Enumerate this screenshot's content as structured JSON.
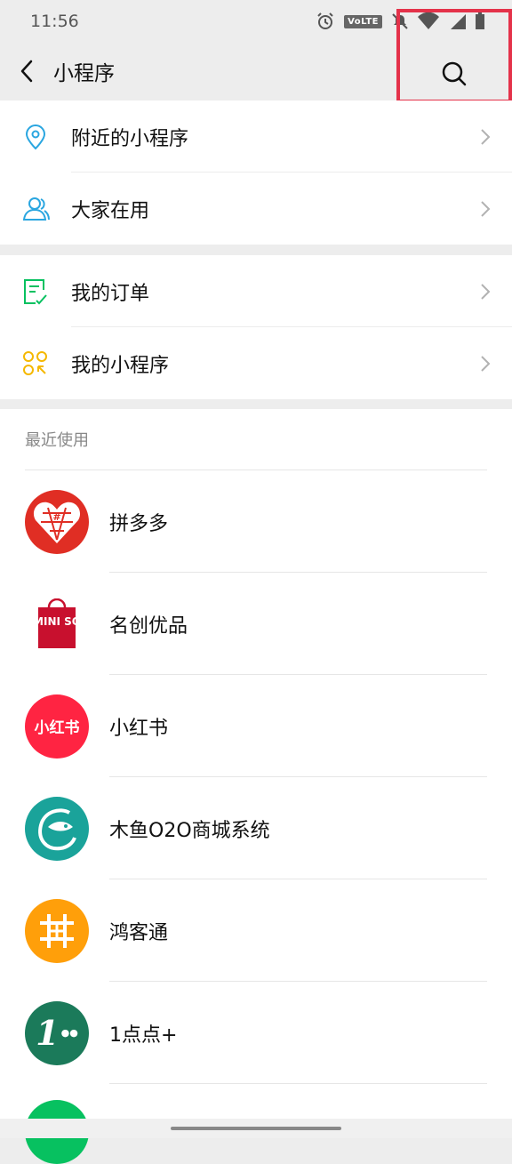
{
  "status": {
    "time": "11:56",
    "volte": "VoLTE"
  },
  "header": {
    "title": "小程序"
  },
  "menu_group1": [
    {
      "label": "附近的小程序",
      "icon": "location-pin-icon"
    },
    {
      "label": "大家在用",
      "icon": "users-icon"
    }
  ],
  "menu_group2": [
    {
      "label": "我的订单",
      "icon": "order-list-icon"
    },
    {
      "label": "我的小程序",
      "icon": "my-miniprograms-icon"
    }
  ],
  "recent": {
    "title": "最近使用",
    "apps": [
      {
        "name": "拼多多",
        "logo_color": "#e02e24"
      },
      {
        "name": "名创优品",
        "logo_text": "MINI SO",
        "logo_color": "#c8102e"
      },
      {
        "name": "小红书",
        "logo_text": "小红书",
        "logo_color": "#ff2442"
      },
      {
        "name": "木鱼O2O商城系统",
        "logo_color": "#1aa39a"
      },
      {
        "name": "鸿客通",
        "logo_color": "#ff9f0a"
      },
      {
        "name": "1点点+",
        "logo_text": "1",
        "logo_color": "#1b7a5a"
      }
    ]
  },
  "colors": {
    "accent_highlight": "#e4324a",
    "wechat_green": "#07c160"
  }
}
